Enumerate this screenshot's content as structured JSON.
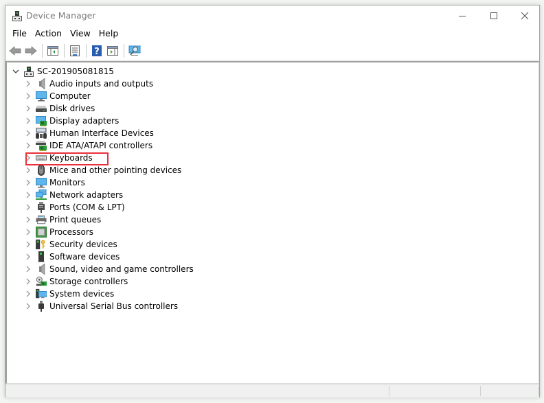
{
  "window": {
    "title": "Device Manager",
    "controls": {
      "minimize": "minimize",
      "maximize": "maximize",
      "close": "close"
    }
  },
  "menubar": {
    "items": [
      "File",
      "Action",
      "View",
      "Help"
    ]
  },
  "toolbar": {
    "buttons": [
      {
        "name": "back",
        "icon": "back-arrow-icon"
      },
      {
        "name": "forward",
        "icon": "forward-arrow-icon"
      },
      {
        "name": "show-hide-console-tree",
        "icon": "console-tree-icon"
      },
      {
        "name": "properties",
        "icon": "properties-icon"
      },
      {
        "name": "help",
        "icon": "help-icon"
      },
      {
        "name": "show-action-pane",
        "icon": "action-pane-icon"
      },
      {
        "name": "scan-hardware-changes",
        "icon": "scan-monitor-icon"
      }
    ]
  },
  "tree": {
    "root": {
      "label": "SC-201905081815",
      "expanded": true,
      "icon": "computer-tower-icon"
    },
    "categories": [
      {
        "label": "Audio inputs and outputs",
        "icon": "speaker-icon"
      },
      {
        "label": "Computer",
        "icon": "monitor-icon"
      },
      {
        "label": "Disk drives",
        "icon": "disk-drive-icon"
      },
      {
        "label": "Display adapters",
        "icon": "display-adapter-icon"
      },
      {
        "label": "Human Interface Devices",
        "icon": "hid-icon"
      },
      {
        "label": "IDE ATA/ATAPI controllers",
        "icon": "ide-controller-icon"
      },
      {
        "label": "Keyboards",
        "icon": "keyboard-icon",
        "highlighted": true
      },
      {
        "label": "Mice and other pointing devices",
        "icon": "mouse-icon"
      },
      {
        "label": "Monitors",
        "icon": "monitor-icon"
      },
      {
        "label": "Network adapters",
        "icon": "network-adapter-icon"
      },
      {
        "label": "Ports (COM & LPT)",
        "icon": "port-icon"
      },
      {
        "label": "Print queues",
        "icon": "printer-icon"
      },
      {
        "label": "Processors",
        "icon": "processor-icon"
      },
      {
        "label": "Security devices",
        "icon": "security-device-icon"
      },
      {
        "label": "Software devices",
        "icon": "software-device-icon"
      },
      {
        "label": "Sound, video and game controllers",
        "icon": "speaker-icon"
      },
      {
        "label": "Storage controllers",
        "icon": "storage-controller-icon"
      },
      {
        "label": "System devices",
        "icon": "system-devices-icon"
      },
      {
        "label": "Universal Serial Bus controllers",
        "icon": "usb-icon"
      }
    ]
  },
  "highlight_color": "#e8303a"
}
